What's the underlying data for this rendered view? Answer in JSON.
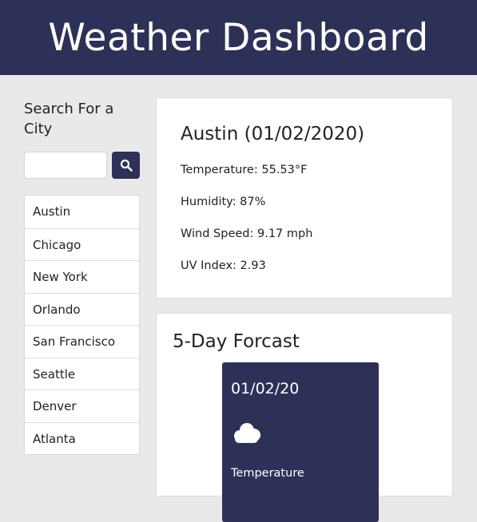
{
  "header": {
    "title": "Weather Dashboard"
  },
  "sidebar": {
    "search_title": "Search For a City",
    "search_placeholder": "",
    "search_button_icon": "search-icon",
    "cities": [
      "Austin",
      "Chicago",
      "New York",
      "Orlando",
      "San Francisco",
      "Seattle",
      "Denver",
      "Atlanta"
    ]
  },
  "current": {
    "title": "Austin (01/02/2020)",
    "temperature": "Temperature: 55.53°F",
    "humidity": "Humidity: 87%",
    "wind": "Wind Speed: 9.17 mph",
    "uv": "UV Index: 2.93"
  },
  "forecast": {
    "title": "5-Day Forcast",
    "days": [
      {
        "date": "01/02/20",
        "icon": "cloud-icon",
        "temperature_label": "Temperature"
      }
    ]
  },
  "colors": {
    "primary": "#2d3158",
    "background": "#e9e9e9"
  }
}
